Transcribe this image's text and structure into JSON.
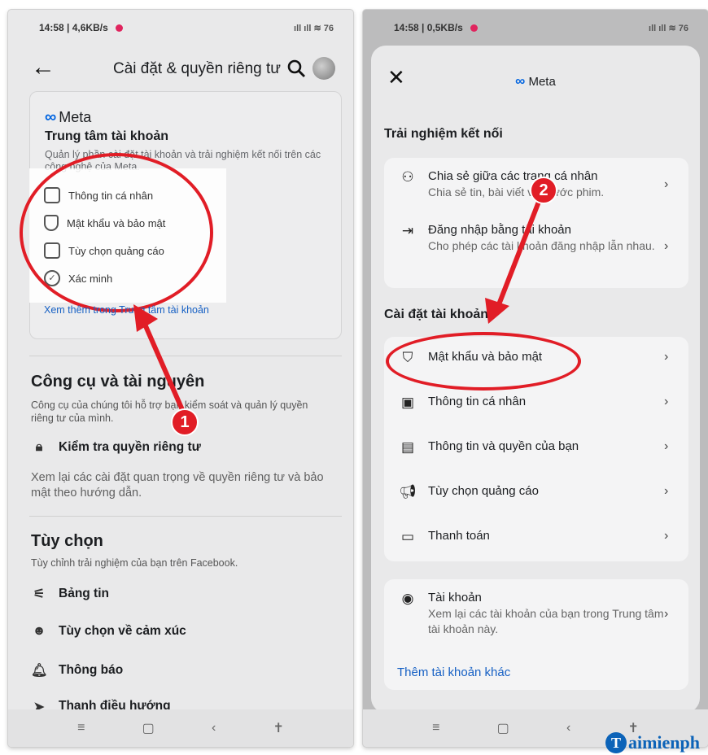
{
  "left": {
    "status": {
      "time": "14:58 | 4,6KB/s",
      "icons": "ıll ıll ≋ 76"
    },
    "header": {
      "title": "Cài đặt & quyền riêng tư"
    },
    "meta_card": {
      "logo": "Meta",
      "title": "Trung tâm tài khoản",
      "description": "Quản lý phần cài đặt tài khoản và trải nghiệm kết nối trên các công nghệ của Meta.",
      "items": [
        {
          "label": "Thông tin cá nhân",
          "icon": "id-card-icon"
        },
        {
          "label": "Mật khẩu và bảo mật",
          "icon": "shield-icon"
        },
        {
          "label": "Tùy chọn quảng cáo",
          "icon": "monitor-icon"
        },
        {
          "label": "Xác minh",
          "icon": "verified-icon"
        }
      ],
      "link": "Xem thêm trong Trung tâm tài khoản"
    },
    "tools": {
      "title": "Công cụ và tài nguyên",
      "description": "Công cụ của chúng tôi hỗ trợ bạn kiểm soát và quản lý quyền riêng tư của mình.",
      "privacy_check": "Kiểm tra quyền riêng tư",
      "privacy_desc": "Xem lại các cài đặt quan trọng về quyền riêng tư và bảo mật theo hướng dẫn."
    },
    "options": {
      "title": "Tùy chọn",
      "description": "Tùy chỉnh trải nghiệm của bạn trên Facebook.",
      "items": [
        "Bảng tin",
        "Tùy chọn về cảm xúc",
        "Thông báo",
        "Thanh điều hướng"
      ]
    },
    "badge": "1"
  },
  "right": {
    "status": {
      "time": "14:58 | 0,5KB/s",
      "icons": "ıll ıll ≋ 76"
    },
    "sheet_logo": "Meta",
    "connected": {
      "title": "Trải nghiệm kết nối",
      "items": [
        {
          "label": "Chia sẻ giữa các trang cá nhân",
          "sub": "Chia sẻ tin, bài viết và thước phim."
        },
        {
          "label": "Đăng nhập bằng tài khoản",
          "sub": "Cho phép các tài khoản đăng nhập lẫn nhau."
        }
      ]
    },
    "account_settings": {
      "title": "Cài đặt tài khoản",
      "items": [
        "Mật khẩu và bảo mật",
        "Thông tin cá nhân",
        "Thông tin và quyền của bạn",
        "Tùy chọn quảng cáo",
        "Thanh toán"
      ]
    },
    "accounts": {
      "label": "Tài khoản",
      "sub": "Xem lại các tài khoản của bạn trong Trung tâm tài khoản này.",
      "add": "Thêm tài khoản khác"
    },
    "badge": "2"
  },
  "nav": {
    "menu": "≡",
    "home": "▢",
    "back": "‹",
    "access": "✝"
  },
  "watermark": "aimienph",
  "colors": {
    "accent": "#e11d26",
    "link": "#1660c4",
    "meta_blue": "#0064e0"
  }
}
